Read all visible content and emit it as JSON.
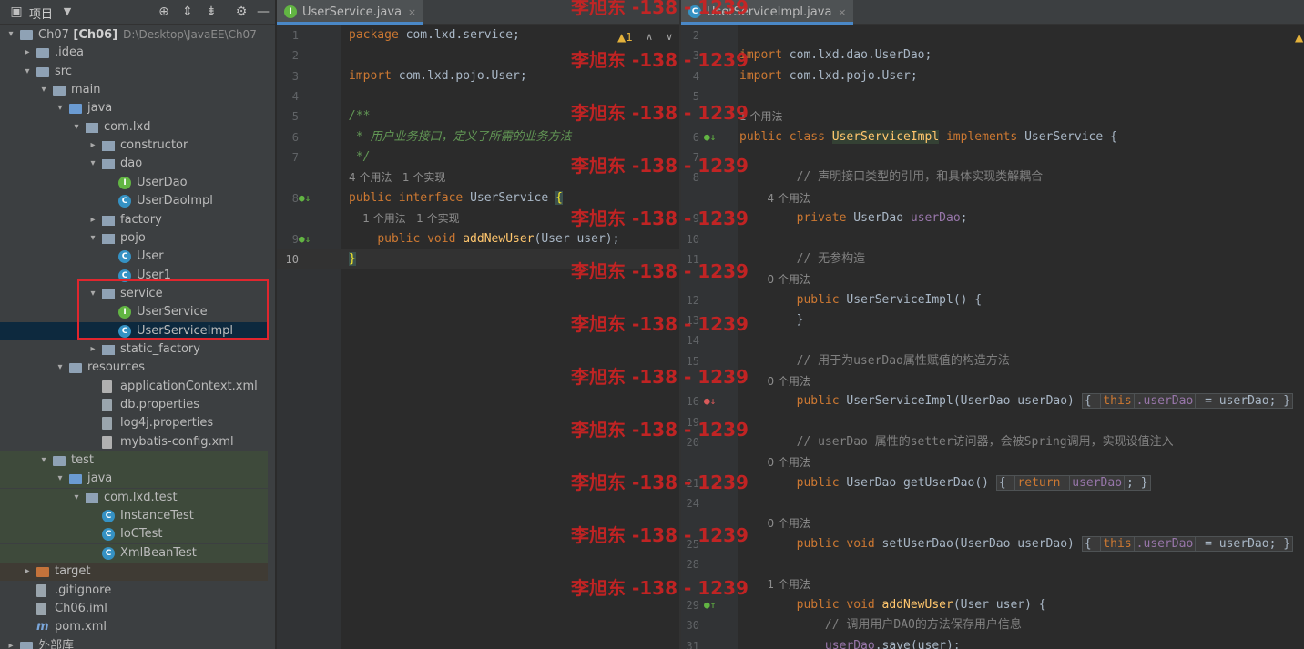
{
  "project_panel": {
    "title": "项目",
    "tree": [
      {
        "label": "Ch07",
        "bold": "[Ch06]",
        "path": "D:\\Desktop\\JavaEE\\Ch07",
        "level": 0,
        "arrow": "▾",
        "icon": "folder"
      },
      {
        "label": ".idea",
        "level": 1,
        "arrow": "▸",
        "icon": "folder"
      },
      {
        "label": "src",
        "level": 1,
        "arrow": "▾",
        "icon": "folder"
      },
      {
        "label": "main",
        "level": 2,
        "arrow": "▾",
        "icon": "folder"
      },
      {
        "label": "java",
        "level": 3,
        "arrow": "▾",
        "icon": "folder-blue"
      },
      {
        "label": "com.lxd",
        "level": 4,
        "arrow": "▾",
        "icon": "package"
      },
      {
        "label": "constructor",
        "level": 5,
        "arrow": "▸",
        "icon": "package"
      },
      {
        "label": "dao",
        "level": 5,
        "arrow": "▾",
        "icon": "package"
      },
      {
        "label": "UserDao",
        "level": 6,
        "arrow": "",
        "icon": "interface"
      },
      {
        "label": "UserDaoImpl",
        "level": 6,
        "arrow": "",
        "icon": "class"
      },
      {
        "label": "factory",
        "level": 5,
        "arrow": "▸",
        "icon": "package"
      },
      {
        "label": "pojo",
        "level": 5,
        "arrow": "▾",
        "icon": "package"
      },
      {
        "label": "User",
        "level": 6,
        "arrow": "",
        "icon": "class"
      },
      {
        "label": "User1",
        "level": 6,
        "arrow": "",
        "icon": "class"
      },
      {
        "label": "service",
        "level": 5,
        "arrow": "▾",
        "icon": "package"
      },
      {
        "label": "UserService",
        "level": 6,
        "arrow": "",
        "icon": "interface"
      },
      {
        "label": "UserServiceImpl",
        "level": 6,
        "arrow": "",
        "icon": "class",
        "selected": true
      },
      {
        "label": "static_factory",
        "level": 5,
        "arrow": "▸",
        "icon": "package"
      },
      {
        "label": "resources",
        "level": 3,
        "arrow": "▾",
        "icon": "folder"
      },
      {
        "label": "applicationContext.xml",
        "level": 5,
        "arrow": "",
        "icon": "xml"
      },
      {
        "label": "db.properties",
        "level": 5,
        "arrow": "",
        "icon": "properties"
      },
      {
        "label": "log4j.properties",
        "level": 5,
        "arrow": "",
        "icon": "properties"
      },
      {
        "label": "mybatis-config.xml",
        "level": 5,
        "arrow": "",
        "icon": "xml"
      },
      {
        "label": "test",
        "level": 2,
        "arrow": "▾",
        "icon": "folder",
        "bg": "test"
      },
      {
        "label": "java",
        "level": 3,
        "arrow": "▾",
        "icon": "folder-blue",
        "bg": "test"
      },
      {
        "label": "com.lxd.test",
        "level": 4,
        "arrow": "▾",
        "icon": "package",
        "bg": "test"
      },
      {
        "label": "InstanceTest",
        "level": 5,
        "arrow": "",
        "icon": "class",
        "bg": "test"
      },
      {
        "label": "IoCTest",
        "level": 5,
        "arrow": "",
        "icon": "class",
        "bg": "test"
      },
      {
        "label": "XmlBeanTest",
        "level": 5,
        "arrow": "",
        "icon": "class",
        "bg": "test"
      },
      {
        "label": "target",
        "level": 1,
        "arrow": "▸",
        "icon": "folder-orange",
        "bg": "target"
      },
      {
        "label": ".gitignore",
        "level": 1,
        "arrow": "",
        "icon": "properties"
      },
      {
        "label": "Ch06.iml",
        "level": 1,
        "arrow": "",
        "icon": "properties"
      },
      {
        "label": "pom.xml",
        "level": 1,
        "arrow": "",
        "icon": "maven"
      },
      {
        "label": "外部库",
        "level": 0,
        "arrow": "▸",
        "icon": "folder"
      }
    ]
  },
  "left_editor": {
    "tab_label": "UserService.java",
    "tab_close": "×",
    "warnings": "▲1",
    "lines": [
      {
        "type": "code",
        "num": "1",
        "parts": [
          [
            "kw",
            "package "
          ],
          [
            "pl",
            "com.lxd.service;"
          ]
        ]
      },
      {
        "type": "code",
        "num": "2",
        "parts": []
      },
      {
        "type": "code",
        "num": "3",
        "parts": [
          [
            "kw",
            "import "
          ],
          [
            "pl",
            "com.lxd.pojo.User;"
          ]
        ]
      },
      {
        "type": "code",
        "num": "4",
        "parts": []
      },
      {
        "type": "code",
        "num": "5",
        "parts": [
          [
            "doc",
            "/**"
          ]
        ]
      },
      {
        "type": "code",
        "num": "6",
        "parts": [
          [
            "doc",
            " * 用户业务接口，定义了所需的业务方法"
          ]
        ]
      },
      {
        "type": "code",
        "num": "7",
        "parts": [
          [
            "doc",
            " */"
          ]
        ]
      },
      {
        "type": "hint",
        "text": "4 个用法   1 个实现"
      },
      {
        "type": "code",
        "num": "8",
        "parts": [
          [
            "kw",
            "public interface "
          ],
          [
            "pl",
            "UserService "
          ],
          [
            "brace",
            "{"
          ]
        ],
        "mark": "impl"
      },
      {
        "type": "hint",
        "text": "    1 个用法   1 个实现"
      },
      {
        "type": "code",
        "num": "9",
        "parts": [
          [
            "pl",
            "    "
          ],
          [
            "kw",
            "public void "
          ],
          [
            "fn",
            "addNewUser"
          ],
          [
            "pl",
            "(User user);"
          ]
        ],
        "mark": "impl"
      },
      {
        "type": "code",
        "num": "10",
        "parts": [
          [
            "brace",
            "}"
          ]
        ],
        "current": true
      }
    ]
  },
  "right_editor": {
    "tab_label": "UserServiceImpl.java",
    "tab_close": "×",
    "warnings": "▲",
    "lines": [
      {
        "type": "code",
        "num": "2",
        "parts": []
      },
      {
        "type": "code",
        "num": "3",
        "parts": [
          [
            "kw",
            "import "
          ],
          [
            "pl",
            "com.lxd.dao.UserDao;"
          ]
        ]
      },
      {
        "type": "code",
        "num": "4",
        "parts": [
          [
            "kw",
            "import "
          ],
          [
            "pl",
            "com.lxd.pojo.User;"
          ]
        ]
      },
      {
        "type": "code",
        "num": "5",
        "parts": []
      },
      {
        "type": "hint",
        "text": "1 个用法"
      },
      {
        "type": "code",
        "num": "6",
        "parts": [
          [
            "kw",
            "public class "
          ],
          [
            "clshl",
            "UserServiceImpl"
          ],
          [
            "kw",
            " implements "
          ],
          [
            "pl",
            "UserService {"
          ]
        ],
        "mark": "impl"
      },
      {
        "type": "code",
        "num": "7",
        "parts": []
      },
      {
        "type": "code",
        "num": "8",
        "parts": [
          [
            "cm",
            "        // 声明接口类型的引用，和具体实现类解耦合"
          ]
        ]
      },
      {
        "type": "hint",
        "text": "        4 个用法"
      },
      {
        "type": "code",
        "num": "9",
        "parts": [
          [
            "pl",
            "        "
          ],
          [
            "kw",
            "private "
          ],
          [
            "pl",
            "UserDao "
          ],
          [
            "fld",
            "userDao"
          ],
          [
            "pl",
            ";"
          ]
        ]
      },
      {
        "type": "code",
        "num": "10",
        "parts": []
      },
      {
        "type": "code",
        "num": "11",
        "parts": [
          [
            "cm",
            "        // 无参构造"
          ]
        ]
      },
      {
        "type": "hint",
        "text": "        0 个用法"
      },
      {
        "type": "code",
        "num": "12",
        "parts": [
          [
            "pl",
            "        "
          ],
          [
            "kw",
            "public "
          ],
          [
            "pl",
            "UserServiceImpl() {"
          ]
        ]
      },
      {
        "type": "code",
        "num": "13",
        "parts": [
          [
            "pl",
            "        }"
          ]
        ]
      },
      {
        "type": "code",
        "num": "14",
        "parts": []
      },
      {
        "type": "code",
        "num": "15",
        "parts": [
          [
            "cm",
            "        // 用于为userDao属性赋值的构造方法"
          ]
        ]
      },
      {
        "type": "hint",
        "text": "        0 个用法"
      },
      {
        "type": "code",
        "num": "16",
        "parts": [
          [
            "pl",
            "        "
          ],
          [
            "kw",
            "public "
          ],
          [
            "pl",
            "UserServiceImpl(UserDao userDao) "
          ],
          [
            "fold",
            "{ "
          ],
          [
            "foldkw",
            "this"
          ],
          [
            "foldfld",
            ".userDao"
          ],
          [
            "fold",
            " = userDao; }"
          ]
        ],
        "mark": "bean"
      },
      {
        "type": "code",
        "num": "19",
        "parts": []
      },
      {
        "type": "code",
        "num": "20",
        "parts": [
          [
            "cm",
            "        // userDao 属性的setter访问器，会被Spring调用，实现设值注入"
          ]
        ]
      },
      {
        "type": "hint",
        "text": "        0 个用法"
      },
      {
        "type": "code",
        "num": "21",
        "parts": [
          [
            "pl",
            "        "
          ],
          [
            "kw",
            "public "
          ],
          [
            "pl",
            "UserDao "
          ],
          [
            "pl",
            "getUserDao() "
          ],
          [
            "fold",
            "{ "
          ],
          [
            "foldkw",
            "return "
          ],
          [
            "foldfld",
            "userDao"
          ],
          [
            "fold",
            "; }"
          ]
        ]
      },
      {
        "type": "code",
        "num": "24",
        "parts": []
      },
      {
        "type": "hint",
        "text": "        0 个用法"
      },
      {
        "type": "code",
        "num": "25",
        "parts": [
          [
            "pl",
            "        "
          ],
          [
            "kw",
            "public void "
          ],
          [
            "pl",
            "setUserDao(UserDao userDao) "
          ],
          [
            "fold",
            "{ "
          ],
          [
            "foldkw",
            "this"
          ],
          [
            "foldfld",
            ".userDao"
          ],
          [
            "fold",
            " = userDao; }"
          ]
        ]
      },
      {
        "type": "code",
        "num": "28",
        "parts": []
      },
      {
        "type": "hint",
        "text": "        1 个用法"
      },
      {
        "type": "code",
        "num": "29",
        "parts": [
          [
            "pl",
            "        "
          ],
          [
            "kw",
            "public void "
          ],
          [
            "fn",
            "addNewUser"
          ],
          [
            "pl",
            "(User user) {"
          ]
        ],
        "mark": "override"
      },
      {
        "type": "code",
        "num": "30",
        "parts": [
          [
            "cm",
            "            // 调用用户DAO的方法保存用户信息"
          ]
        ]
      },
      {
        "type": "code",
        "num": "31",
        "parts": [
          [
            "pl",
            "            "
          ],
          [
            "fld",
            "userDao"
          ],
          [
            "pl",
            ".save(user);"
          ]
        ]
      }
    ]
  },
  "watermark": {
    "text": "李旭东 -138 - 1239",
    "count": 12
  }
}
